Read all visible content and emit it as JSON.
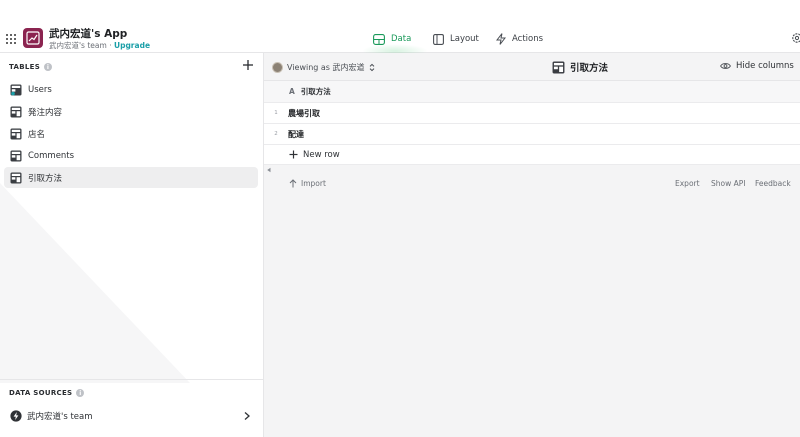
{
  "header": {
    "app_title": "武内宏道's App",
    "team_name": "武内宏道's team",
    "separator": "·",
    "upgrade": "Upgrade",
    "tabs": [
      {
        "label": "Data",
        "active": true
      },
      {
        "label": "Layout",
        "active": false
      },
      {
        "label": "Actions",
        "active": false
      }
    ]
  },
  "sidebar": {
    "tables_heading": "TABLES",
    "tables": [
      {
        "label": "Users",
        "selected": false
      },
      {
        "label": "発注内容",
        "selected": false
      },
      {
        "label": "店名",
        "selected": false
      },
      {
        "label": "Comments",
        "selected": false
      },
      {
        "label": "引取方法",
        "selected": true
      }
    ],
    "data_sources_heading": "DATA SOURCES",
    "data_source": "武内宏道's team"
  },
  "main": {
    "viewing_as": "Viewing as 武内宏道",
    "table_title": "引取方法",
    "hide_columns": "Hide columns",
    "column": {
      "type_glyph": "A",
      "name": "引取方法"
    },
    "rows": [
      {
        "num": "1",
        "value": "農場引取"
      },
      {
        "num": "2",
        "value": "配達"
      }
    ],
    "new_row": "New row",
    "import": "Import",
    "export": "Export",
    "show_api": "Show API",
    "feedback": "Feedback"
  },
  "colors": {
    "accent_green": "#1a9a5a",
    "upgrade_teal": "#1a9fa8",
    "app_logo": "#8b2450"
  },
  "icons": [
    "apps-grid-icon",
    "app-logo-icon",
    "data-icon",
    "layout-icon",
    "actions-bolt-icon",
    "settings-gear-icon",
    "add-icon",
    "info-icon",
    "table-icon",
    "user-table-icon",
    "avatar",
    "chevron-updown-icon",
    "eye-icon",
    "plus-icon",
    "arrow-up-icon",
    "chevron-right-icon",
    "collapse-left-icon",
    "bolt-icon"
  ]
}
